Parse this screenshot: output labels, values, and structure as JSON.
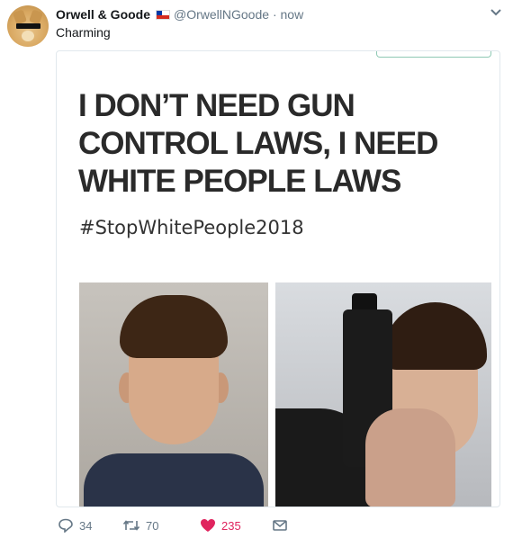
{
  "tweet": {
    "display_name": "Orwell & Goode",
    "handle": "@OrwellNGoode",
    "separator": "·",
    "time": "now",
    "text": "Charming",
    "flag_icon": "chile-flag-icon",
    "avatar": "doge-sunglasses-avatar"
  },
  "card": {
    "headline": "I DON’T NEED GUN CONTROL LAWS, I NEED WHITE PEOPLE LAWS",
    "hashtag": "#StopWhitePeople2018"
  },
  "actions": {
    "reply_count": "34",
    "retweet_count": "70",
    "like_count": "235",
    "icons": [
      "reply-icon",
      "retweet-icon",
      "heart-icon",
      "message-icon"
    ],
    "like_color": "#e0245e",
    "retweet_color": "#17bf63"
  }
}
